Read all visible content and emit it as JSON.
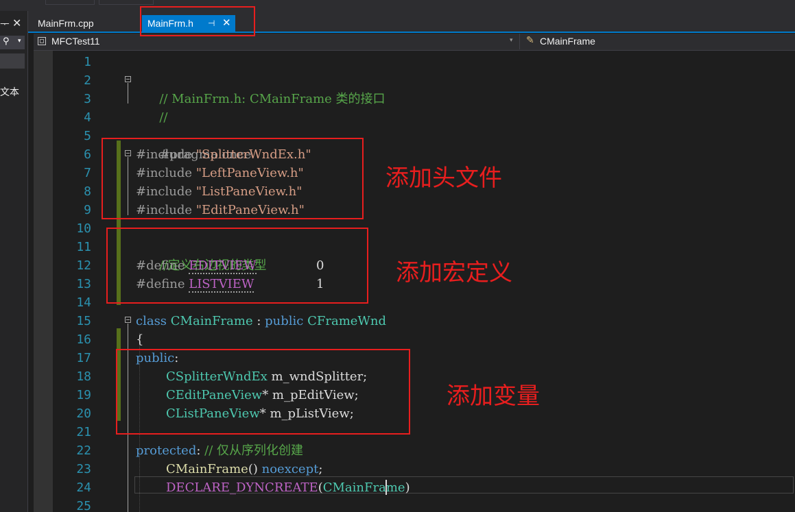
{
  "left_panel": {
    "pin_glyph": "ᅮ",
    "close_glyph": "✕",
    "search_glyph": "⚲",
    "dropdown_glyph": "▾",
    "partial_text": "文本"
  },
  "tabs": [
    {
      "label": "MainFrm.cpp",
      "active": false
    },
    {
      "label": "MainFrm.h",
      "active": true,
      "pin_glyph": "⊣",
      "close_glyph": "✕"
    }
  ],
  "navbar": {
    "project_label": "MFCTest11",
    "dropdown_glyph": "▾",
    "class_icon_glyph": "✎",
    "class_label": "CMainFrame"
  },
  "editor": {
    "line_numbers": [
      "1",
      "2",
      "3",
      "4",
      "5",
      "6",
      "7",
      "8",
      "9",
      "10",
      "11",
      "12",
      "13",
      "14",
      "15",
      "16",
      "17",
      "18",
      "19",
      "20",
      "21",
      "22",
      "23",
      "24",
      "25"
    ],
    "code": {
      "l2_comment": "// MainFrm.h: CMainFrame 类的接口",
      "l3_comment": "//",
      "l5_pragma": "#pragma once",
      "l6_inc": "#include ",
      "l6_file": "\"SplitterWndEx.h\"",
      "l7_inc": "#include ",
      "l7_file": "\"LeftPaneView.h\"",
      "l8_inc": "#include ",
      "l8_file": "\"ListPaneView.h\"",
      "l9_inc": "#include ",
      "l9_file": "\"EditPaneView.h\"",
      "l11_comment": "//定义右边视的类型",
      "l12_def": "#define ",
      "l12_name": "EDITVIEW",
      "l12_val": "0",
      "l13_def": "#define ",
      "l13_name": "LISTVIEW",
      "l13_val": "1",
      "l15_kw": "class",
      "l15_cls": "CMainFrame",
      "l15_colon": " : ",
      "l15_pub": "public",
      "l15_base": "CFrameWnd",
      "l16_brace": "{",
      "l17_kw": "public",
      "l17_colon": ":",
      "l18_type": "CSplitterWndEx",
      "l18_var": " m_wndSplitter;",
      "l19_type": "CEditPaneView",
      "l19_var": "* m_pEditView;",
      "l20_type": "CListPaneView",
      "l20_var": "* m_pListView;",
      "l22_kw": "protected",
      "l22_colon": ":",
      "l22_comment": " // 仅从序列化创建",
      "l23_fn": "CMainFrame",
      "l23_parens": "()",
      "l23_kw": " noexcept",
      "l23_semi": ";",
      "l24_macro": "DECLARE_DYNCREATE",
      "l24_open": "(",
      "l24_arg": "CMainFrame",
      "l24_close": ")"
    }
  },
  "annotations": {
    "headers": "添加头文件",
    "macros": "添加宏定义",
    "variables": "添加变量",
    "color": "#e81e1e"
  }
}
